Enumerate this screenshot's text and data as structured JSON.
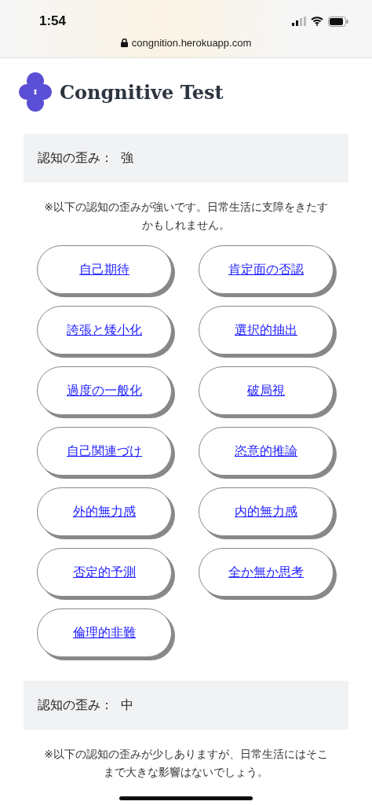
{
  "status_bar": {
    "time": "1:54"
  },
  "address_bar": {
    "url": "congnition.herokuapp.com"
  },
  "header": {
    "title": "Congnitive Test"
  },
  "sections": [
    {
      "label": "認知の歪み：",
      "level_text": "強",
      "note": "※以下の認知の歪みが強いです。日常生活に支障をきたすかもしれません。",
      "links": [
        "自己期待",
        "肯定面の否認",
        "誇張と矮小化",
        "選択的抽出",
        "過度の一般化",
        "破局視",
        "自己関連づけ",
        "恣意的推論",
        "外的無力感",
        "内的無力感",
        "否定的予測",
        "全か無か思考",
        "倫理的非難"
      ]
    },
    {
      "label": "認知の歪み：",
      "level_text": "中",
      "note": "※以下の認知の歪みが少しありますが、日常生活にはそこまで大きな影響はないでしょう。"
    }
  ]
}
